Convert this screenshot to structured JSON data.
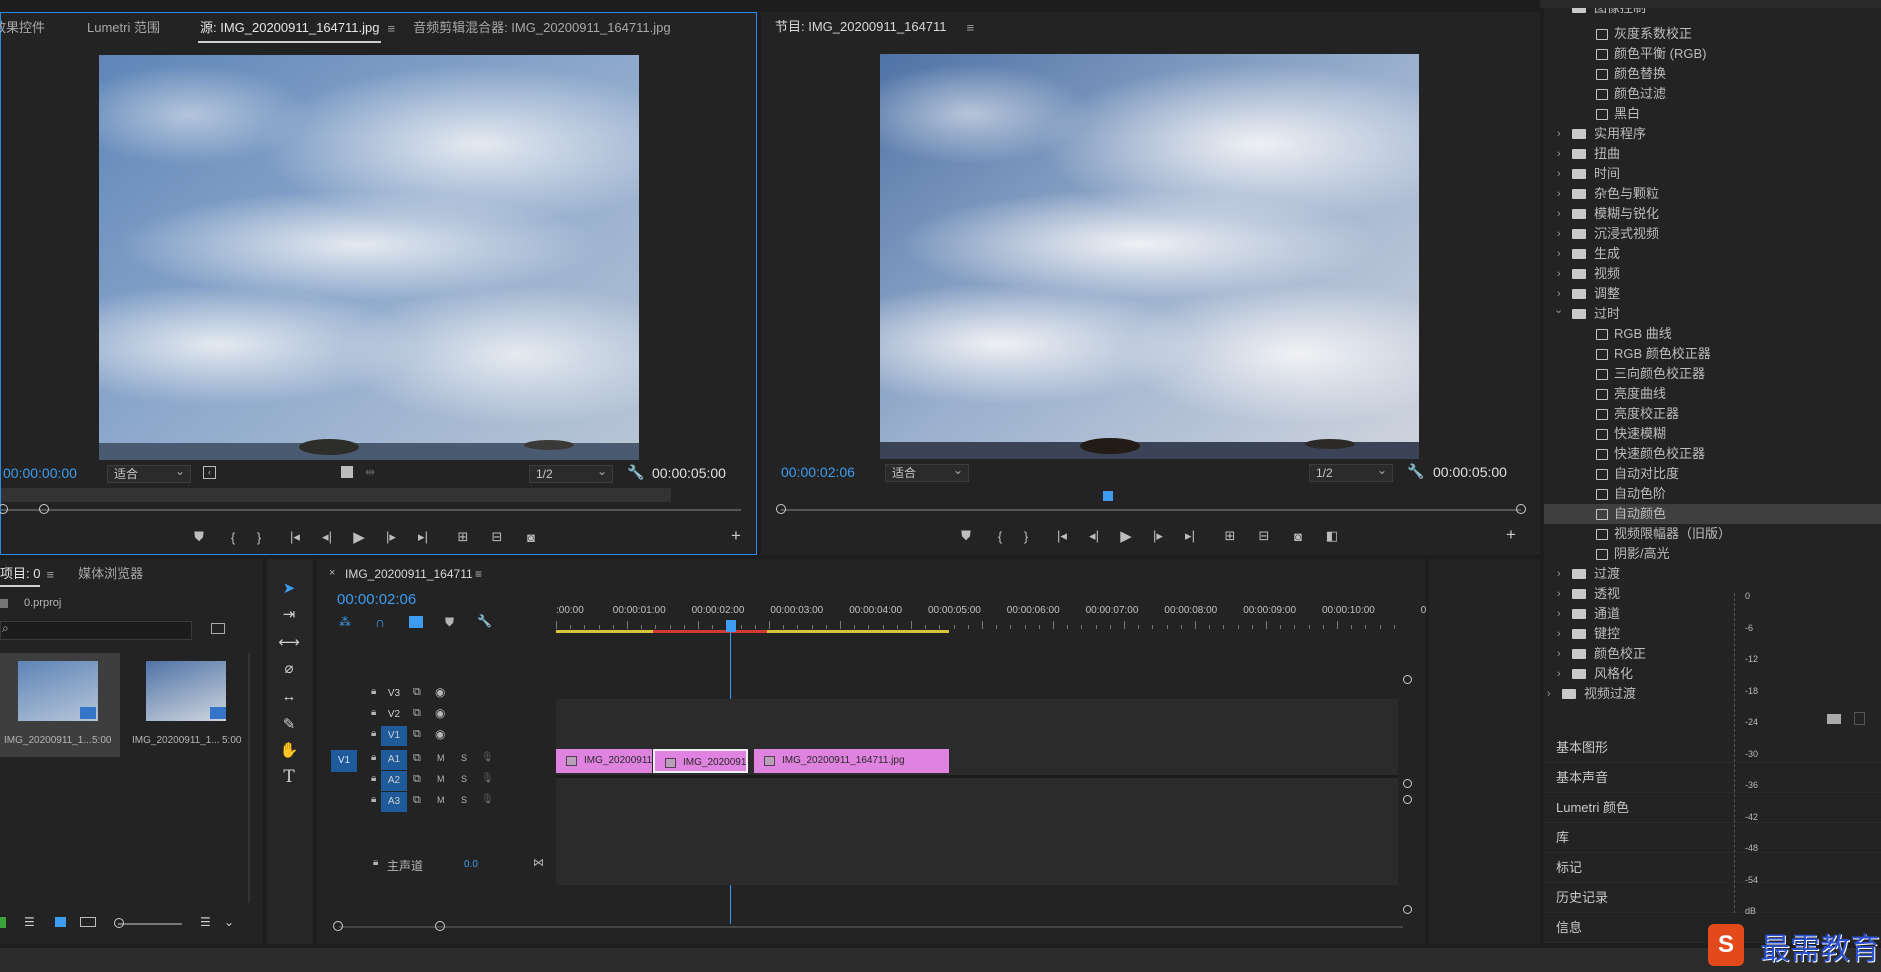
{
  "source_panel": {
    "tabs": [
      {
        "label": "效果控件"
      },
      {
        "label": "Lumetri 范围"
      },
      {
        "label": "源: IMG_20200911_164711.jpg"
      },
      {
        "label": "音频剪辑混合器: IMG_20200911_164711.jpg"
      }
    ],
    "timecode": "00:00:00:00",
    "fit": "适合",
    "resolution": "1/2",
    "duration": "00:00:05:00"
  },
  "program_panel": {
    "tab": "节目: IMG_20200911_164711",
    "timecode": "00:00:02:06",
    "fit": "适合",
    "resolution": "1/2",
    "duration": "00:00:05:00"
  },
  "effects_panel": {
    "rows": [
      {
        "label": "图像控制",
        "kind": "folder-open",
        "indent": 1
      },
      {
        "label": "灰度系数校正",
        "kind": "effect",
        "indent": 2
      },
      {
        "label": "颜色平衡 (RGB)",
        "kind": "effect",
        "indent": 2
      },
      {
        "label": "颜色替换",
        "kind": "effect",
        "indent": 2
      },
      {
        "label": "颜色过滤",
        "kind": "effect",
        "indent": 2
      },
      {
        "label": "黑白",
        "kind": "effect",
        "indent": 2
      },
      {
        "label": "实用程序",
        "kind": "folder",
        "indent": 1
      },
      {
        "label": "扭曲",
        "kind": "folder",
        "indent": 1
      },
      {
        "label": "时间",
        "kind": "folder",
        "indent": 1
      },
      {
        "label": "杂色与颗粒",
        "kind": "folder",
        "indent": 1
      },
      {
        "label": "模糊与锐化",
        "kind": "folder",
        "indent": 1
      },
      {
        "label": "沉浸式视频",
        "kind": "folder",
        "indent": 1
      },
      {
        "label": "生成",
        "kind": "folder",
        "indent": 1
      },
      {
        "label": "视频",
        "kind": "folder",
        "indent": 1
      },
      {
        "label": "调整",
        "kind": "folder",
        "indent": 1
      },
      {
        "label": "过时",
        "kind": "folder-open",
        "indent": 1
      },
      {
        "label": "RGB 曲线",
        "kind": "effect",
        "indent": 2
      },
      {
        "label": "RGB 颜色校正器",
        "kind": "effect",
        "indent": 2
      },
      {
        "label": "三向颜色校正器",
        "kind": "effect",
        "indent": 2
      },
      {
        "label": "亮度曲线",
        "kind": "effect",
        "indent": 2
      },
      {
        "label": "亮度校正器",
        "kind": "effect",
        "indent": 2
      },
      {
        "label": "快速模糊",
        "kind": "effect",
        "indent": 2
      },
      {
        "label": "快速颜色校正器",
        "kind": "effect",
        "indent": 2
      },
      {
        "label": "自动对比度",
        "kind": "effect",
        "indent": 2
      },
      {
        "label": "自动色阶",
        "kind": "effect",
        "indent": 2
      },
      {
        "label": "自动颜色",
        "kind": "effect",
        "indent": 2,
        "selected": true
      },
      {
        "label": "视频限幅器（旧版）",
        "kind": "effect",
        "indent": 2
      },
      {
        "label": "阴影/高光",
        "kind": "effect",
        "indent": 2
      },
      {
        "label": "过渡",
        "kind": "folder",
        "indent": 1
      },
      {
        "label": "透视",
        "kind": "folder",
        "indent": 1
      },
      {
        "label": "通道",
        "kind": "folder",
        "indent": 1
      },
      {
        "label": "键控",
        "kind": "folder",
        "indent": 1
      },
      {
        "label": "颜色校正",
        "kind": "folder",
        "indent": 1
      },
      {
        "label": "风格化",
        "kind": "folder",
        "indent": 1
      },
      {
        "label": "视频过渡",
        "kind": "folder",
        "indent": 0
      }
    ],
    "sections": [
      "基本图形",
      "基本声音",
      "Lumetri 颜色",
      "库",
      "标记",
      "历史记录",
      "信息"
    ]
  },
  "project_panel": {
    "tabs": [
      {
        "label": "项目: 0"
      },
      {
        "label": "媒体浏览器"
      }
    ],
    "filename": "0.prproj",
    "items": [
      {
        "name": "IMG_20200911_1...",
        "duration": "5:00"
      },
      {
        "name": "IMG_20200911_1...",
        "duration": "5:00"
      }
    ]
  },
  "timeline": {
    "tab": "IMG_20200911_164711",
    "timecode": "00:00:02:06",
    "ruler": [
      ":00:00",
      "00:00:01:00",
      "00:00:02:00",
      "00:00:03:00",
      "00:00:04:00",
      "00:00:05:00",
      "00:00:06:00",
      "00:00:07:00",
      "00:00:08:00",
      "00:00:09:00",
      "00:00:10:00",
      "0"
    ],
    "video_tracks": [
      "V3",
      "V2",
      "V1"
    ],
    "audio_tracks": [
      "A1",
      "A2",
      "A3"
    ],
    "source_patch": "V1",
    "master": {
      "label": "主声道",
      "value": "0.0"
    },
    "mute": "M",
    "solo": "S",
    "clips": [
      {
        "label": "IMG_20200911"
      },
      {
        "label": "IMG_20200911"
      },
      {
        "label": "IMG_20200911_164711.jpg"
      }
    ]
  },
  "meter": {
    "labels": [
      "0",
      "-6",
      "-12",
      "-18",
      "-24",
      "-30",
      "-36",
      "-42",
      "-48",
      "-54",
      "dB"
    ]
  },
  "watermark": {
    "text": "最需教育"
  }
}
